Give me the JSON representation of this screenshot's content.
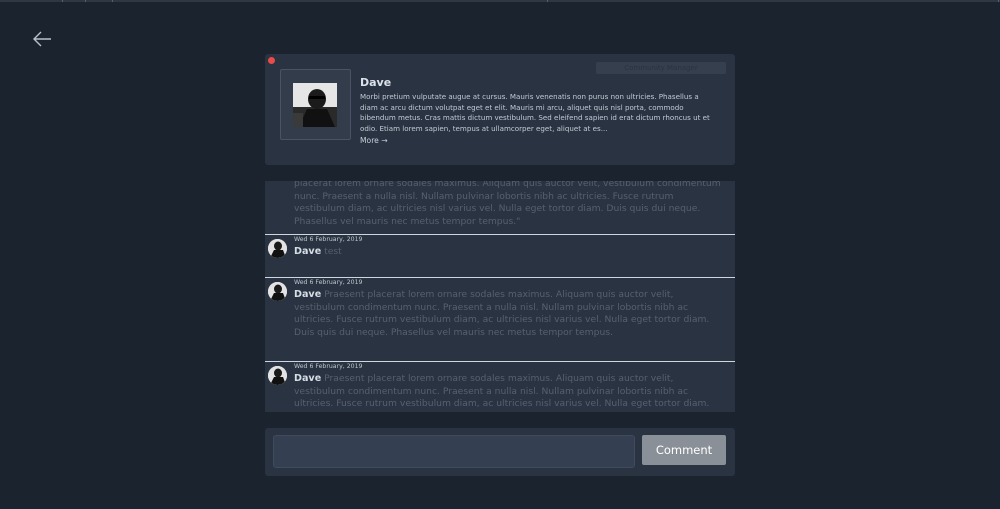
{
  "profile": {
    "name": "Dave",
    "role": "Community Manager",
    "status_color": "#e94b4b",
    "bio": "Morbi pretium vulputate augue at cursus. Mauris venenatis non purus non ultricies. Phasellus a diam ac arcu dictum volutpat eget et elit. Mauris mi arcu, aliquet quis nisl porta, commodo bibendum metus. Cras mattis dictum vestibulum. Sed eleifend sapien id erat dictum rhoncus ut et odio. Etiam lorem sapien, tempus at ullamcorper eget, aliquet at es...",
    "more_label": "More →"
  },
  "comments": {
    "partial_text": "placerat lorem ornare sodales maximus. Aliquam quis auctor velit, vestibulum condimentum nunc. Praesent a nulla nisl. Nullam pulvinar lobortis nibh ac ultricies. Fusce rutrum vestibulum diam, ac ultricies nisl varius vel. Nulla eget tortor diam. Duis quis dui neque. Phasellus vel mauris nec metus tempor tempus.\"",
    "items": [
      {
        "date": "Wed 6 February, 2019",
        "author": "Dave",
        "text": "test"
      },
      {
        "date": "Wed 6 February, 2019",
        "author": "Dave",
        "text": "Praesent placerat lorem ornare sodales maximus. Aliquam quis auctor velit, vestibulum condimentum nunc. Praesent a nulla nisl. Nullam pulvinar lobortis nibh ac ultricies. Fusce rutrum vestibulum diam, ac ultricies nisl varius vel. Nulla eget tortor diam. Duis quis dui neque. Phasellus vel mauris nec metus tempor tempus."
      },
      {
        "date": "Wed 6 February, 2019",
        "author": "Dave",
        "text": "Praesent placerat lorem ornare sodales maximus. Aliquam quis auctor velit, vestibulum condimentum nunc. Praesent a nulla nisl. Nullam pulvinar lobortis nibh ac ultricies. Fusce rutrum vestibulum diam, ac ultricies nisl varius vel. Nulla eget tortor diam."
      }
    ]
  },
  "compose": {
    "input_value": "",
    "button_label": "Comment"
  },
  "icons": {
    "back": "arrow-left-icon"
  }
}
